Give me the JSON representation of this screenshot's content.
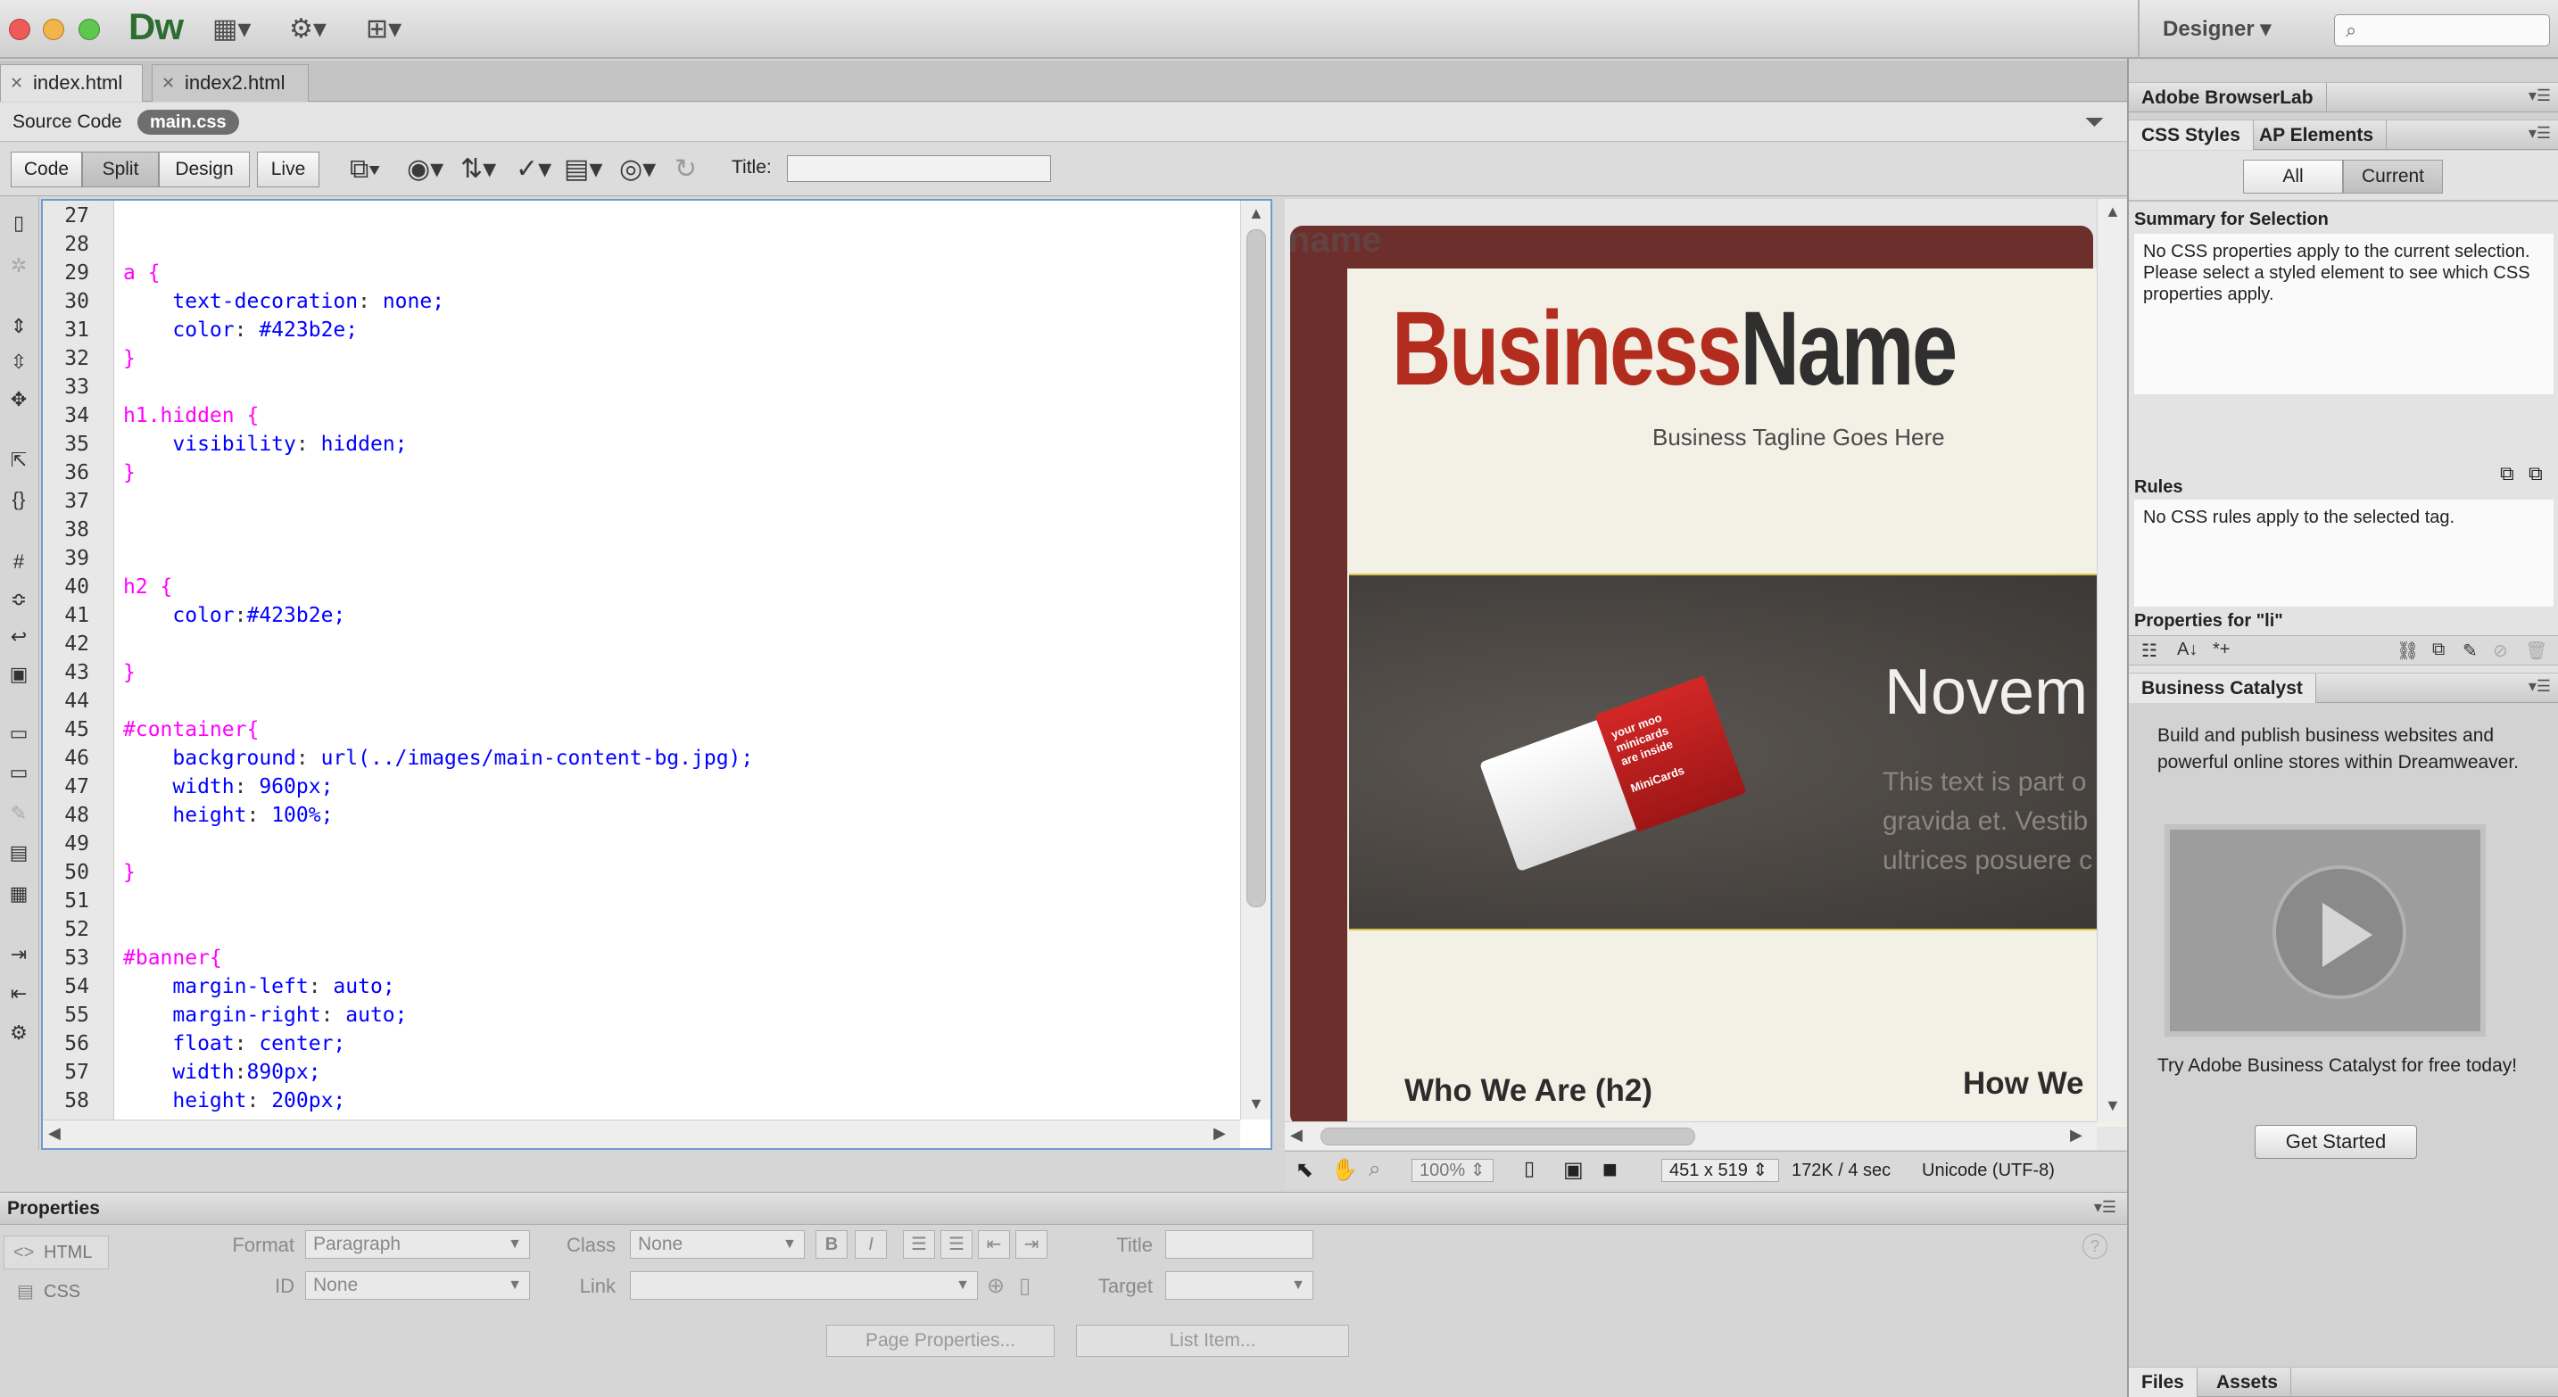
{
  "app": {
    "logo": "Dw",
    "workspace": "Designer",
    "icons": [
      "layout-icon",
      "gear-icon",
      "site-icon"
    ]
  },
  "doc_tabs": [
    "index.html",
    "index2.html"
  ],
  "related_files": {
    "source_label": "Source Code",
    "active_file": "main.css"
  },
  "doc_toolbar": {
    "views": [
      "Code",
      "Split",
      "Design",
      "Live"
    ],
    "active_view": "Split",
    "title_label": "Title:",
    "title_value": ""
  },
  "code": {
    "lines": [
      {
        "n": "27",
        "t": ""
      },
      {
        "n": "28",
        "t": ""
      },
      {
        "n": "29",
        "t": "a {",
        "k": "sel"
      },
      {
        "n": "30",
        "t": "    text-decoration: none;",
        "k": "prop"
      },
      {
        "n": "31",
        "t": "    color: #423b2e;",
        "k": "prop"
      },
      {
        "n": "32",
        "t": "}",
        "k": "sel"
      },
      {
        "n": "33",
        "t": ""
      },
      {
        "n": "34",
        "t": "h1.hidden {",
        "k": "sel"
      },
      {
        "n": "35",
        "t": "    visibility: hidden;",
        "k": "prop"
      },
      {
        "n": "36",
        "t": "}",
        "k": "sel"
      },
      {
        "n": "37",
        "t": ""
      },
      {
        "n": "38",
        "t": ""
      },
      {
        "n": "39",
        "t": ""
      },
      {
        "n": "40",
        "t": "h2 {",
        "k": "sel"
      },
      {
        "n": "41",
        "t": "    color:#423b2e;",
        "k": "prop"
      },
      {
        "n": "42",
        "t": ""
      },
      {
        "n": "43",
        "t": "}",
        "k": "sel"
      },
      {
        "n": "44",
        "t": ""
      },
      {
        "n": "45",
        "t": "#container{",
        "k": "sel"
      },
      {
        "n": "46",
        "t": "    background: url(../images/main-content-bg.jpg);",
        "k": "prop"
      },
      {
        "n": "47",
        "t": "    width: 960px;",
        "k": "prop"
      },
      {
        "n": "48",
        "t": "    height: 100%;",
        "k": "prop"
      },
      {
        "n": "49",
        "t": ""
      },
      {
        "n": "50",
        "t": "}",
        "k": "sel"
      },
      {
        "n": "51",
        "t": ""
      },
      {
        "n": "52",
        "t": ""
      },
      {
        "n": "53",
        "t": "#banner{",
        "k": "sel"
      },
      {
        "n": "54",
        "t": "    margin-left: auto;",
        "k": "prop"
      },
      {
        "n": "55",
        "t": "    margin-right: auto;",
        "k": "prop"
      },
      {
        "n": "56",
        "t": "    float: center;",
        "k": "prop"
      },
      {
        "n": "57",
        "t": "    width:890px;",
        "k": "prop"
      },
      {
        "n": "58",
        "t": "    height: 200px;",
        "k": "prop"
      }
    ]
  },
  "design": {
    "faint_label": "name",
    "business_name_1": "Business",
    "business_name_2": "Name",
    "tagline": "Business Tagline Goes Here",
    "card_text": "your moo\nminicards\nare inside",
    "card_brand": "MiniCards",
    "banner_heading": "Novem",
    "banner_text": "This text is part o\ngravida et. Vestib\nultrices posuere c",
    "section_1": "Who We Are (h2)",
    "section_2": "How We"
  },
  "status": {
    "zoom": "100%",
    "window_size": "451 x 519",
    "download": "172K / 4 sec",
    "encoding": "Unicode (UTF-8)"
  },
  "properties": {
    "title": "Properties",
    "html_btn": "HTML",
    "css_btn": "CSS",
    "format_label": "Format",
    "format_value": "Paragraph",
    "id_label": "ID",
    "id_value": "None",
    "class_label": "Class",
    "class_value": "None",
    "link_label": "Link",
    "link_value": "",
    "title_label": "Title",
    "title_value": "",
    "target_label": "Target",
    "target_value": "",
    "page_properties": "Page Properties...",
    "list_item": "List Item..."
  },
  "right": {
    "browserlab": "Adobe BrowserLab",
    "css_styles_tab": "CSS Styles",
    "ap_elements_tab": "AP Elements",
    "all_btn": "All",
    "current_btn": "Current",
    "summary_title": "Summary for Selection",
    "summary_text": "No CSS properties apply to the current selection.  Please select a styled element to see which CSS properties apply.",
    "rules_title": "Rules",
    "rules_text": "No CSS rules apply to the selected tag.",
    "props_for": "Properties for \"li\"",
    "bc_title": "Business Catalyst",
    "bc_text": "Build and publish business websites and powerful online stores within Dreamweaver.",
    "bc_try": "Try Adobe Business Catalyst for free today!",
    "get_started": "Get Started",
    "files_tab": "Files",
    "assets_tab": "Assets"
  },
  "colors": {
    "selector": "#ff00ff",
    "property": "#0000ff",
    "brand_red": "#b32d1f",
    "dw_green": "#2e6d32"
  }
}
